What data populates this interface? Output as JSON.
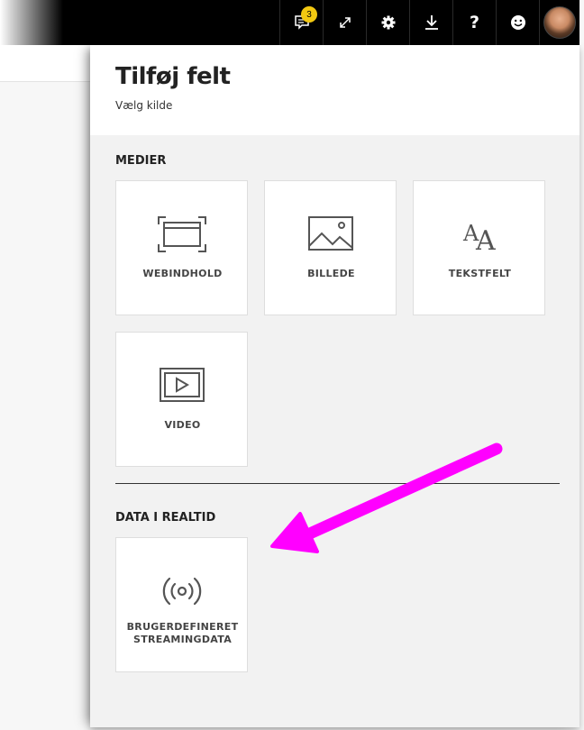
{
  "topbar": {
    "notification_count": "3",
    "buttons": [
      {
        "name": "notifications-icon"
      },
      {
        "name": "fullscreen-icon"
      },
      {
        "name": "gear-icon"
      },
      {
        "name": "download-icon"
      },
      {
        "name": "help-icon",
        "glyph": "?"
      },
      {
        "name": "smiley-icon"
      },
      {
        "name": "avatar"
      }
    ]
  },
  "panel": {
    "title": "Tilføj felt",
    "subtitle": "Vælg kilde",
    "sections": [
      {
        "title": "MEDIER",
        "tiles": [
          {
            "label": "WEBINDHOLD",
            "icon": "web-content-icon"
          },
          {
            "label": "BILLEDE",
            "icon": "image-icon"
          },
          {
            "label": "TEKSTFELT",
            "icon": "text-box-icon",
            "glyph_small": "A",
            "glyph_large": "A"
          },
          {
            "label": "VIDEO",
            "icon": "video-icon"
          }
        ]
      },
      {
        "title": "DATA I REALTID",
        "tiles": [
          {
            "label_line1": "BRUGERDEFINERET",
            "label_line2": "STREAMINGDATA",
            "icon": "streaming-icon"
          }
        ]
      }
    ]
  },
  "colors": {
    "accent_badge": "#f2c811",
    "annotation_arrow": "#ff00ff",
    "topbar": "#000000",
    "panel_background": "#f2f2f2"
  }
}
